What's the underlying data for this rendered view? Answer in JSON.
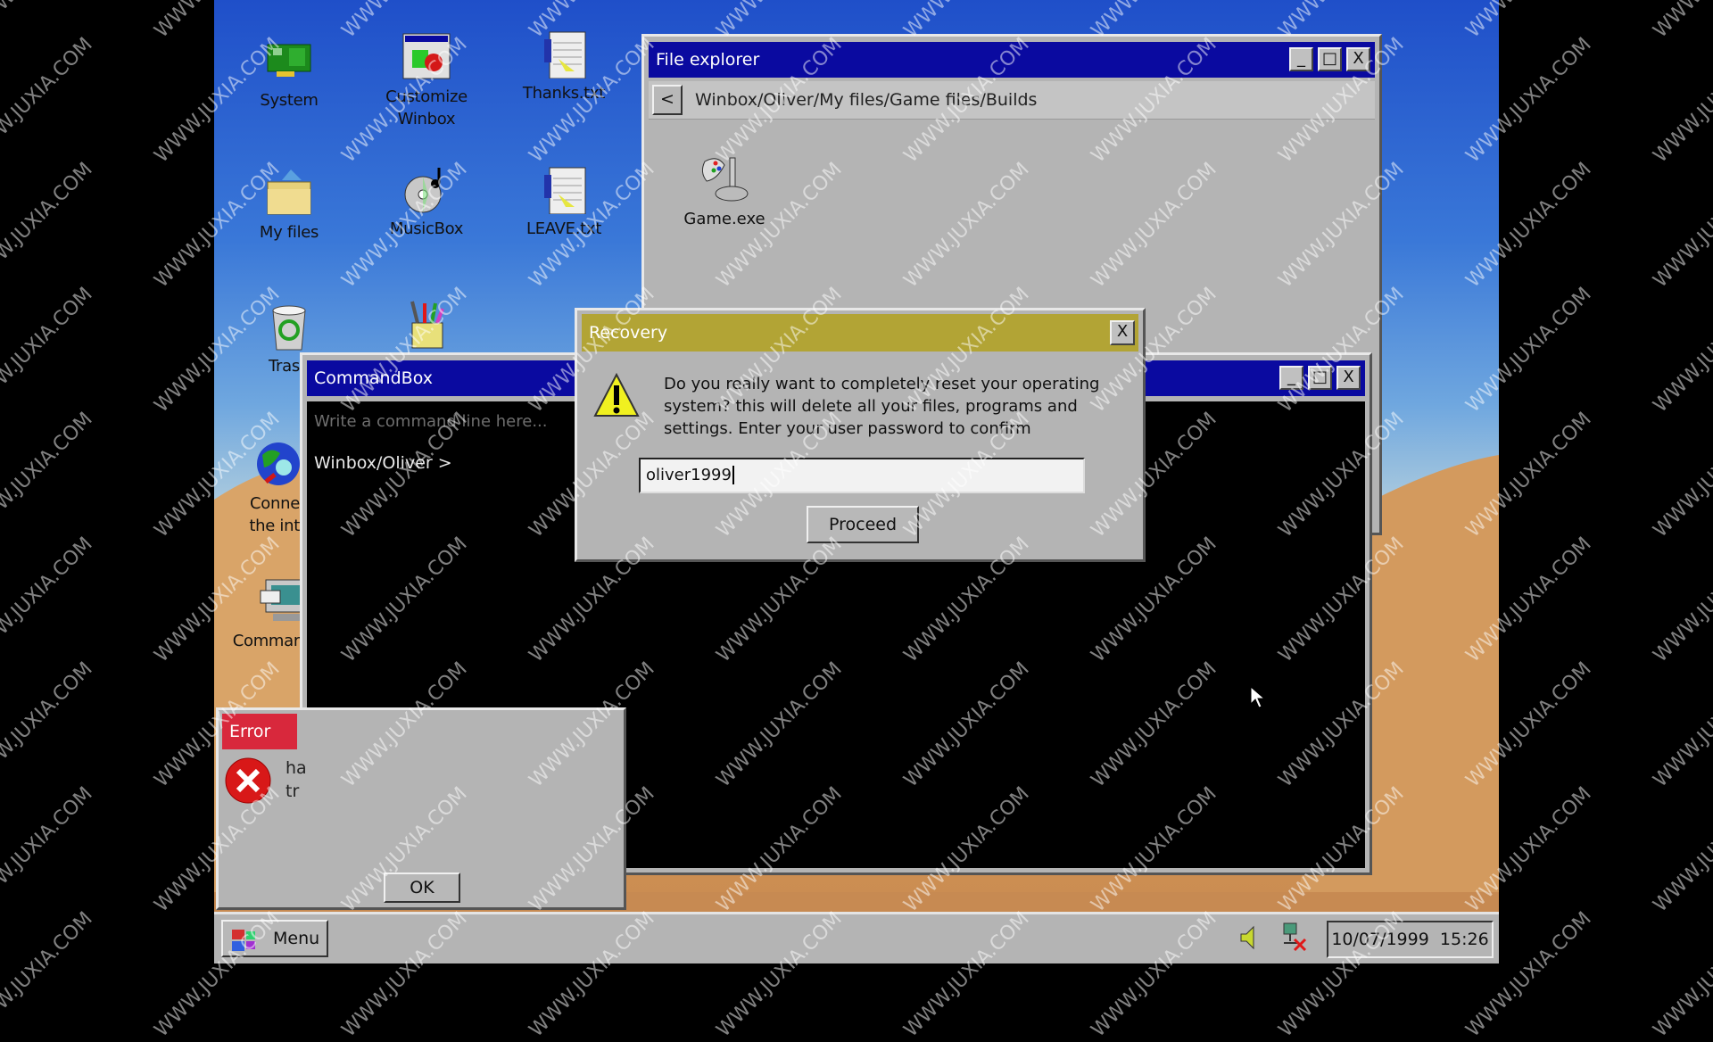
{
  "desktop": {
    "icons": [
      {
        "label": "System",
        "icon": "circuit-board-icon"
      },
      {
        "label": "Customize",
        "label2": "Winbox",
        "icon": "customize-window-icon"
      },
      {
        "label": "Thanks.txt",
        "icon": "notepad-icon"
      },
      {
        "label": "My files",
        "icon": "folder-icon"
      },
      {
        "label": "MusicBox",
        "icon": "cd-music-icon"
      },
      {
        "label": "LEAVE.txt",
        "icon": "notepad-icon"
      },
      {
        "label": "Trash",
        "icon": "recycle-bin-icon"
      },
      {
        "label": "",
        "icon": "paint-bucket-icon"
      },
      {
        "label": "Conne",
        "label2": "the int",
        "icon": "globe-icon"
      },
      {
        "label": "Commar",
        "icon": "computer-terminal-icon"
      }
    ]
  },
  "file_explorer": {
    "title": "File explorer",
    "path": "Winbox/Oliver/My files/Game files/Builds",
    "back_label": "<",
    "files": [
      {
        "name": "Game.exe",
        "icon": "joystick-icon"
      }
    ]
  },
  "commandbox": {
    "title": "CommandBox",
    "placeholder": "Write a command line here...",
    "prompt": "Winbox/Oliver >"
  },
  "recovery": {
    "title": "Recovery",
    "message": "Do you really want to completely reset your operating system? this will delete all your files, programs and settings. Enter your user password to confirm",
    "password_value": "oliver1999",
    "proceed_label": "Proceed",
    "close_label": "X"
  },
  "error_dialog": {
    "title": "Error",
    "message_line1": "ha",
    "message_line2": "tr",
    "ok_label": "OK"
  },
  "window_controls": {
    "minimize": "_",
    "maximize": "□",
    "close": "X"
  },
  "taskbar": {
    "menu_label": "Menu",
    "date": "10/07/1999",
    "time": "15:26"
  },
  "watermark": "WWW.JUXIA.COM",
  "colors": {
    "title_blue": "#0a0aa0",
    "recovery_gold": "#b2a435",
    "error_red": "#d8283c",
    "window_gray": "#b4b4b4"
  }
}
